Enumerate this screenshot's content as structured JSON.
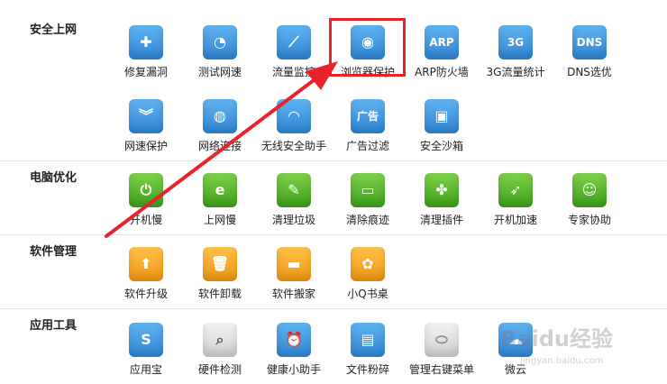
{
  "sections": [
    {
      "title": "安全上网",
      "tools": [
        {
          "label": "修复漏洞",
          "icon": "shield-repair-icon",
          "color": "#3b8fdc"
        },
        {
          "label": "测试网速",
          "icon": "speedometer-icon",
          "color": "#3b8fdc"
        },
        {
          "label": "流量监控",
          "icon": "line-chart-icon",
          "color": "#3b8fdc"
        },
        {
          "label": "浏览器保护",
          "icon": "browser-shield-icon",
          "color": "#3b8fdc"
        },
        {
          "label": "ARP防火墙",
          "icon": "arp-firewall-icon",
          "color": "#3b8fdc"
        },
        {
          "label": "3G流量统计",
          "icon": "3g-icon",
          "color": "#3b8fdc"
        },
        {
          "label": "DNS选优",
          "icon": "dns-icon",
          "color": "#3b8fdc"
        },
        {
          "label": "网速保护",
          "icon": "double-chevron-shield-icon",
          "color": "#3b8fdc"
        },
        {
          "label": "网络连接",
          "icon": "globe-icon",
          "color": "#3b8fdc"
        },
        {
          "label": "无线安全助手",
          "icon": "wifi-icon",
          "color": "#3b8fdc"
        },
        {
          "label": "广告过滤",
          "icon": "ad-block-icon",
          "color": "#3b8fdc"
        },
        {
          "label": "安全沙箱",
          "icon": "sandbox-icon",
          "color": "#3b8fdc"
        }
      ]
    },
    {
      "title": "电脑优化",
      "tools": [
        {
          "label": "开机慢",
          "icon": "power-icon",
          "color": "#4cae24"
        },
        {
          "label": "上网慢",
          "icon": "ie-icon",
          "color": "#4cae24"
        },
        {
          "label": "清理垃圾",
          "icon": "broom-icon",
          "color": "#4cae24"
        },
        {
          "label": "清除痕迹",
          "icon": "eraser-icon",
          "color": "#4cae24"
        },
        {
          "label": "清理插件",
          "icon": "puzzle-icon",
          "color": "#4cae24"
        },
        {
          "label": "开机加速",
          "icon": "rocket-icon",
          "color": "#4cae24"
        },
        {
          "label": "专家协助",
          "icon": "expert-icon",
          "color": "#4cae24"
        }
      ]
    },
    {
      "title": "软件管理",
      "tools": [
        {
          "label": "软件升级",
          "icon": "upgrade-arrow-icon",
          "color": "#f2a01a"
        },
        {
          "label": "软件卸载",
          "icon": "trash-icon",
          "color": "#f2a01a"
        },
        {
          "label": "软件搬家",
          "icon": "truck-icon",
          "color": "#f2a01a"
        },
        {
          "label": "小Q书桌",
          "icon": "clover-icon",
          "color": "#f2a01a"
        }
      ]
    },
    {
      "title": "应用工具",
      "tools": [
        {
          "label": "应用宝",
          "icon": "app-store-icon",
          "color": "#3b8fdc"
        },
        {
          "label": "硬件检测",
          "icon": "magnifier-icon",
          "color": "#cccccc"
        },
        {
          "label": "健康小助手",
          "icon": "alarm-clock-icon",
          "color": "#3b8fdc"
        },
        {
          "label": "文件粉碎",
          "icon": "shredder-icon",
          "color": "#3b8fdc"
        },
        {
          "label": "管理右键菜单",
          "icon": "mouse-icon",
          "color": "#cccccc"
        },
        {
          "label": "微云",
          "icon": "cloud-icon",
          "color": "#3b8fdc"
        }
      ]
    }
  ],
  "glyphs": {
    "repair": "✚",
    "speed": "◔",
    "chart": "⟋",
    "browser": "◉",
    "arp": "ARP",
    "g3": "3G",
    "dns": "DNS",
    "netprotect": "︾",
    "globe": "◍",
    "wifi": "◠",
    "ad": "广告",
    "sandbox": "▣",
    "power": "⏻",
    "ie": "e",
    "broom": "✎",
    "eraser": "▭",
    "puzzle": "✤",
    "rocket": "➶",
    "expert": "☺",
    "upgrade": "⬆",
    "trash": "🗑",
    "truck": "▬",
    "clover": "✿",
    "app": "S",
    "magnifier": "⌕",
    "clock": "⏰",
    "shredder": "▤",
    "mouse": "⬭",
    "cloud": "☁"
  },
  "watermark": {
    "text": "Baidu经验",
    "sub": "jingyan.baidu.com"
  }
}
